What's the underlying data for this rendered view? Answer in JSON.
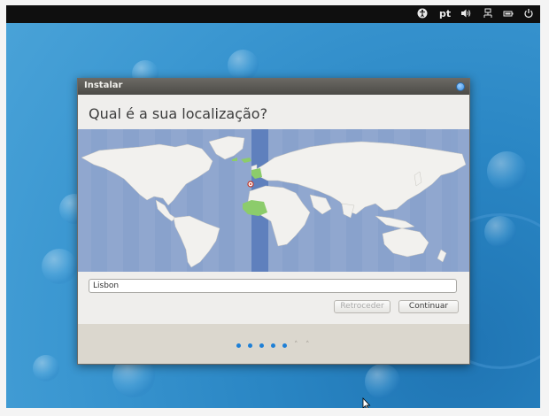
{
  "topbar": {
    "accessibility_icon": "accessibility-icon",
    "keyboard_layout": "pt",
    "volume_icon": "volume-icon",
    "network_icon": "network-icon",
    "battery_icon": "battery-icon",
    "power_icon": "power-icon"
  },
  "window": {
    "title": "Instalar",
    "heading": "Qual é a sua localização?"
  },
  "location": {
    "value": "Lisbon"
  },
  "buttons": {
    "back_label": "Retroceder",
    "continue_label": "Continuar"
  },
  "progress": {
    "completed_steps": 5,
    "total_steps": 7
  },
  "colors": {
    "accent": "#1e7fd6",
    "map_ocean": "#90a7cf",
    "land": "#f2f1ee",
    "timezone_band": "#5f80bd",
    "selected_timezone": "#8ccc6b"
  }
}
